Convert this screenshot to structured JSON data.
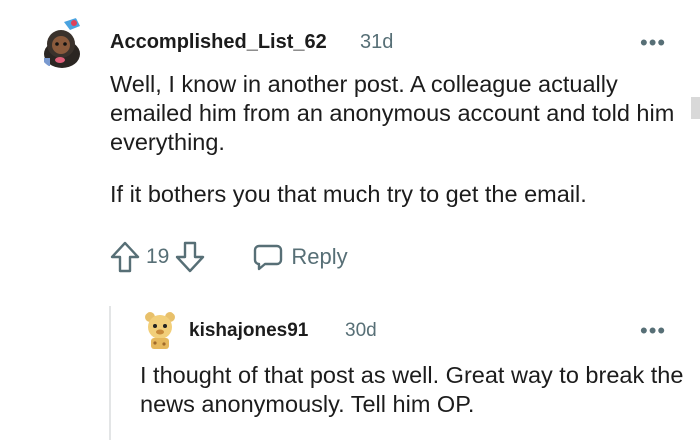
{
  "comments": [
    {
      "author": "Accomplished_List_62",
      "age": "31d",
      "avatar_icon": "snoo-avatar-icon",
      "body": [
        "Well, I know in another post. A colleague actually emailed him from an anonymous account and told him everything.",
        "If it bothers you that much try to get the email."
      ],
      "votes": "19",
      "reply_label": "Reply",
      "more_label": "•••"
    },
    {
      "author": "kishajones91",
      "age": "30d",
      "avatar_icon": "snoo-avatar-icon",
      "body": [
        "I thought of that post as well. Great way to break the news anonymously. Tell him OP."
      ],
      "more_label": "•••"
    }
  ],
  "colors": {
    "text": "#1c1c1c",
    "meta": "#576f76",
    "thread_line": "#e3e5e6"
  }
}
